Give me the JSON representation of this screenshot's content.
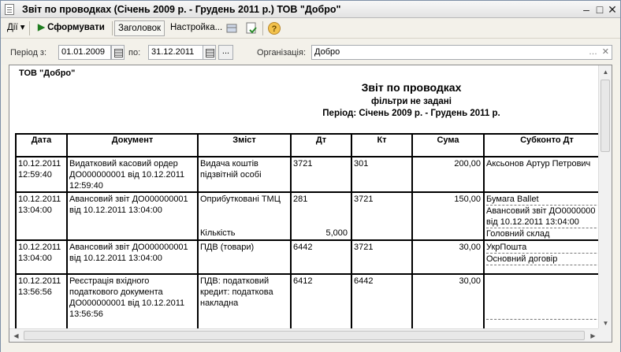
{
  "window": {
    "title": "Звіт по проводках (Січень 2009 р. - Грудень 2011 р.) ТОВ \"Добро\""
  },
  "toolbar": {
    "actions": "Дії",
    "generate": "Сформувати",
    "header": "Заголовок",
    "settings": "Настройка...",
    "help": "?"
  },
  "filters": {
    "period_from_label": "Період з:",
    "period_from": "01.01.2009",
    "period_to_label": "по:",
    "period_to": "31.12.2011",
    "dots": "...",
    "org_label": "Організація:",
    "org": "Добро"
  },
  "report": {
    "org": "ТОВ \"Добро\"",
    "title": "Звіт по проводках",
    "filter_note": "фільтри не задані",
    "period": "Період: Січень 2009 р. - Грудень 2011 р.",
    "columns": [
      "Дата",
      "Документ",
      "Зміст",
      "Дт",
      "Кт",
      "Сума",
      "Субконто Дт"
    ],
    "rows": [
      {
        "date": "10.12.2011",
        "time": "12:59:40",
        "doc1": "Видатковий касовий ордер",
        "doc2": "ДО000000001 від 10.12.2011",
        "doc3": "12:59:40",
        "content1": "Видача коштів",
        "content2": "підзвітній особі",
        "dt": "3721",
        "kt": "301",
        "sum": "200,00",
        "sub1": "Аксьонов Артур Петрович",
        "sub2": "",
        "sub3": ""
      },
      {
        "date": "10.12.2011",
        "time": "13:04:00",
        "doc1": "Авансовий звіт ДО000000001",
        "doc2": "від 10.12.2011 13:04:00",
        "doc3": "",
        "content1": "Оприбутковані ТМЦ",
        "content2": "Кількість",
        "dt": "281",
        "dt_qty": "5,000",
        "kt": "3721",
        "sum": "150,00",
        "sub1": "Бумага Ballet",
        "sub2": "Авансовий звіт ДО0000000",
        "sub2b": "від 10.12.2011 13:04:00",
        "sub3": "Головний склад"
      },
      {
        "date": "10.12.2011",
        "time": "13:04:00",
        "doc1": "Авансовий звіт ДО000000001",
        "doc2": "від 10.12.2011 13:04:00",
        "doc3": "",
        "content1": "ПДВ (товари)",
        "content2": "",
        "dt": "6442",
        "kt": "3721",
        "sum": "30,00",
        "sub1": "УкрПошта",
        "sub2": "Основний договір",
        "sub3": ""
      },
      {
        "date": "10.12.2011",
        "time": "13:56:56",
        "doc1": "Реєстрація вхідного",
        "doc2": "податкового документа",
        "doc3": "ДО000000001 від 10.12.2011",
        "doc4": "13:56:56",
        "content1": "ПДВ: податковий",
        "content2": "кредит: податкова",
        "content3": "накладна",
        "dt": "6412",
        "kt": "6442",
        "sum": "30,00",
        "sub1": "",
        "sub2": "",
        "sub3": ""
      }
    ]
  }
}
